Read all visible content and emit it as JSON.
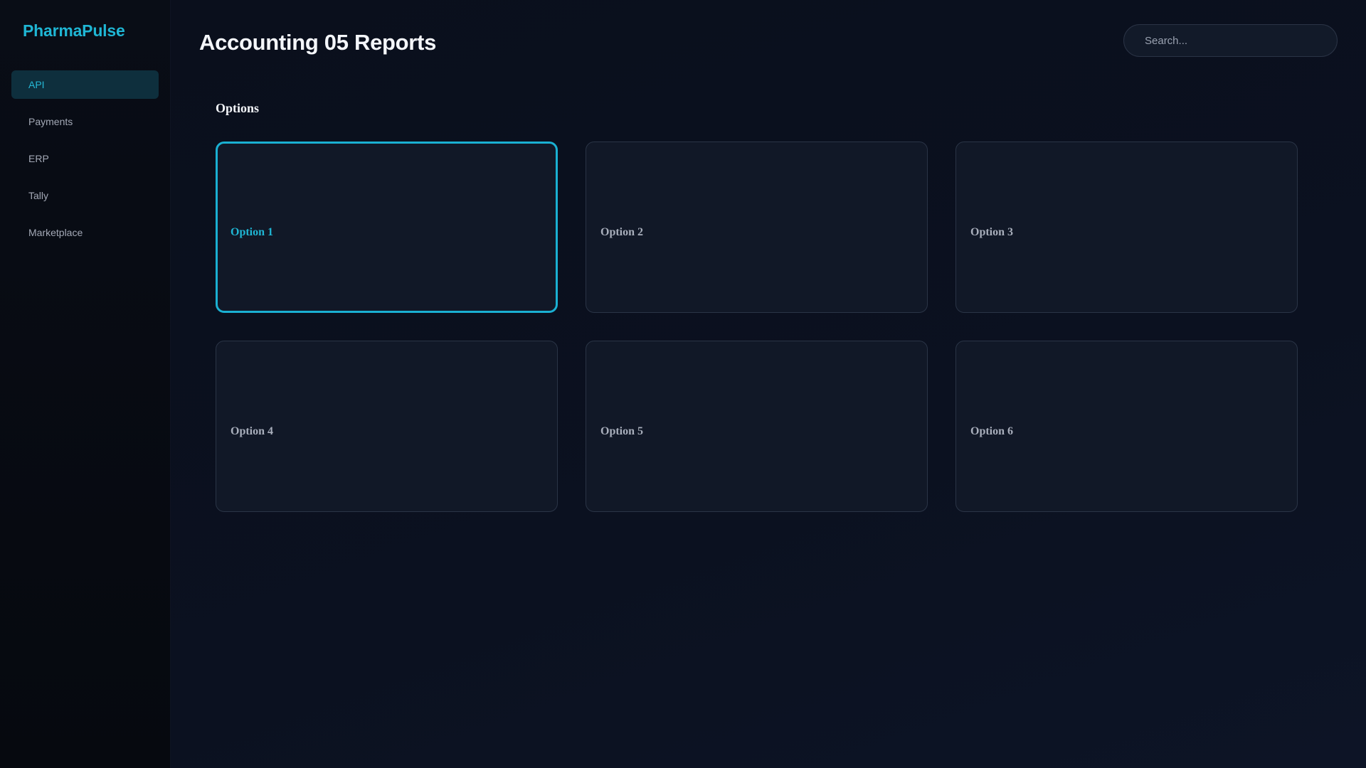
{
  "app": {
    "brand": "PharmaPulse",
    "accent": "#1fb6d4"
  },
  "sidebar": {
    "items": [
      {
        "label": "API",
        "active": true
      },
      {
        "label": "Payments",
        "active": false
      },
      {
        "label": "ERP",
        "active": false
      },
      {
        "label": "Tally",
        "active": false
      },
      {
        "label": "Marketplace",
        "active": false
      }
    ]
  },
  "header": {
    "title": "Accounting 05 Reports",
    "search": {
      "placeholder": "Search...",
      "value": ""
    }
  },
  "options": {
    "title": "Options",
    "items": [
      {
        "label": "Option 1",
        "selected": true
      },
      {
        "label": "Option 2",
        "selected": false
      },
      {
        "label": "Option 3",
        "selected": false
      },
      {
        "label": "Option 4",
        "selected": false
      },
      {
        "label": "Option 5",
        "selected": false
      },
      {
        "label": "Option 6",
        "selected": false
      }
    ]
  }
}
